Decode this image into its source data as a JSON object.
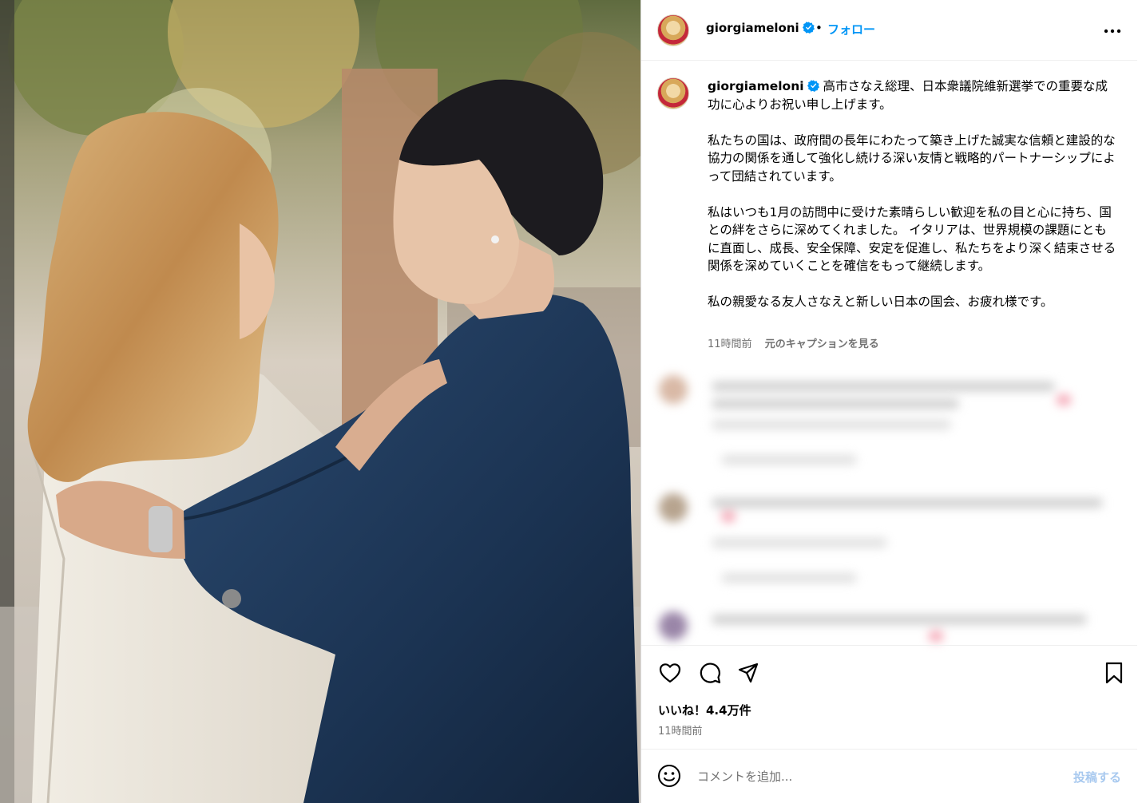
{
  "post": {
    "username": "giorgiameloni",
    "follow_label": "フォロー",
    "separator": "•",
    "more_icon": "more-horizontal-icon"
  },
  "caption": {
    "username": "giorgiameloni",
    "paragraphs": [
      "高市さなえ総理、日本衆議院維新選挙での重要な成功に心よりお祝い申し上げます。",
      "私たちの国は、政府間の長年にわたって築き上げた誠実な信頼と建設的な協力の関係を通して強化し続ける深い友情と戦略的パートナーシップによって団結されています。",
      "私はいつも1月の訪問中に受けた素晴らしい歓迎を私の目と心に持ち、国との絆をさらに深めてくれました。 イタリアは、世界規模の課題にともに直面し、成長、安全保障、安定を促進し、私たちをより深く結束させる関係を深めていくことを確信をもって継続します。",
      "私の親愛なる友人さなえと新しい日本の国会、お疲れ様です。"
    ],
    "time": "11時間前",
    "see_original": "元のキャプションを見る"
  },
  "actions": {
    "like_icon": "heart-icon",
    "comment_icon": "comment-icon",
    "share_icon": "send-icon",
    "save_icon": "bookmark-icon",
    "likes_text": "いいね！4.4万件",
    "time": "11時間前"
  },
  "comment_box": {
    "placeholder": "コメントを追加...",
    "post_label": "投稿する",
    "emoji_icon": "emoji-icon"
  },
  "colors": {
    "link_blue": "#0095f6",
    "post_disabled": "#a8c9ef",
    "verified_blue": "#0095f6",
    "muted": "#737373"
  }
}
